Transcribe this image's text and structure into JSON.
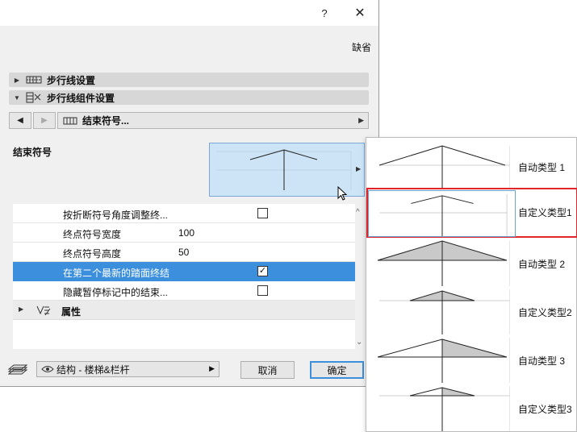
{
  "dialog": {
    "help_label": "?",
    "close_label": "✕",
    "default_label": "缺省"
  },
  "panels": {
    "walkline_settings": "步行线设置",
    "walkline_component_settings": "步行线组件设置"
  },
  "nav": {
    "prev_label": "◀",
    "next_label": "▶",
    "current": "结束符号..."
  },
  "end_symbol": {
    "label": "结束符号"
  },
  "settings_rows": [
    {
      "label": "按折断符号角度调整终...",
      "value": "",
      "checkbox": false
    },
    {
      "label": "终点符号宽度",
      "value": "100"
    },
    {
      "label": "终点符号高度",
      "value": "50"
    },
    {
      "label": "在第二个最新的踏面终结",
      "value": "",
      "checkbox": true,
      "selected": true
    },
    {
      "label": "隐藏暂停标记中的结束...",
      "value": "",
      "checkbox": false
    }
  ],
  "attributes_label": "属性",
  "footer": {
    "layer": "结构 - 楼梯&栏杆",
    "cancel_label": "取消",
    "ok_label": "确定"
  },
  "popup": {
    "items": [
      {
        "label": "自动类型 1",
        "style": "open-wide"
      },
      {
        "label": "自定义类型1",
        "style": "open-small",
        "highlight": true
      },
      {
        "label": "自动类型 2",
        "style": "filled-wide"
      },
      {
        "label": "自定义类型2",
        "style": "filled-small"
      },
      {
        "label": "自动类型 3",
        "style": "half-wide"
      },
      {
        "label": "自定义类型3",
        "style": "half-small"
      }
    ]
  },
  "colors": {
    "selection": "#3c8fdc",
    "highlight_frame": "#e0262b",
    "preview_bg": "#cde4f7"
  }
}
